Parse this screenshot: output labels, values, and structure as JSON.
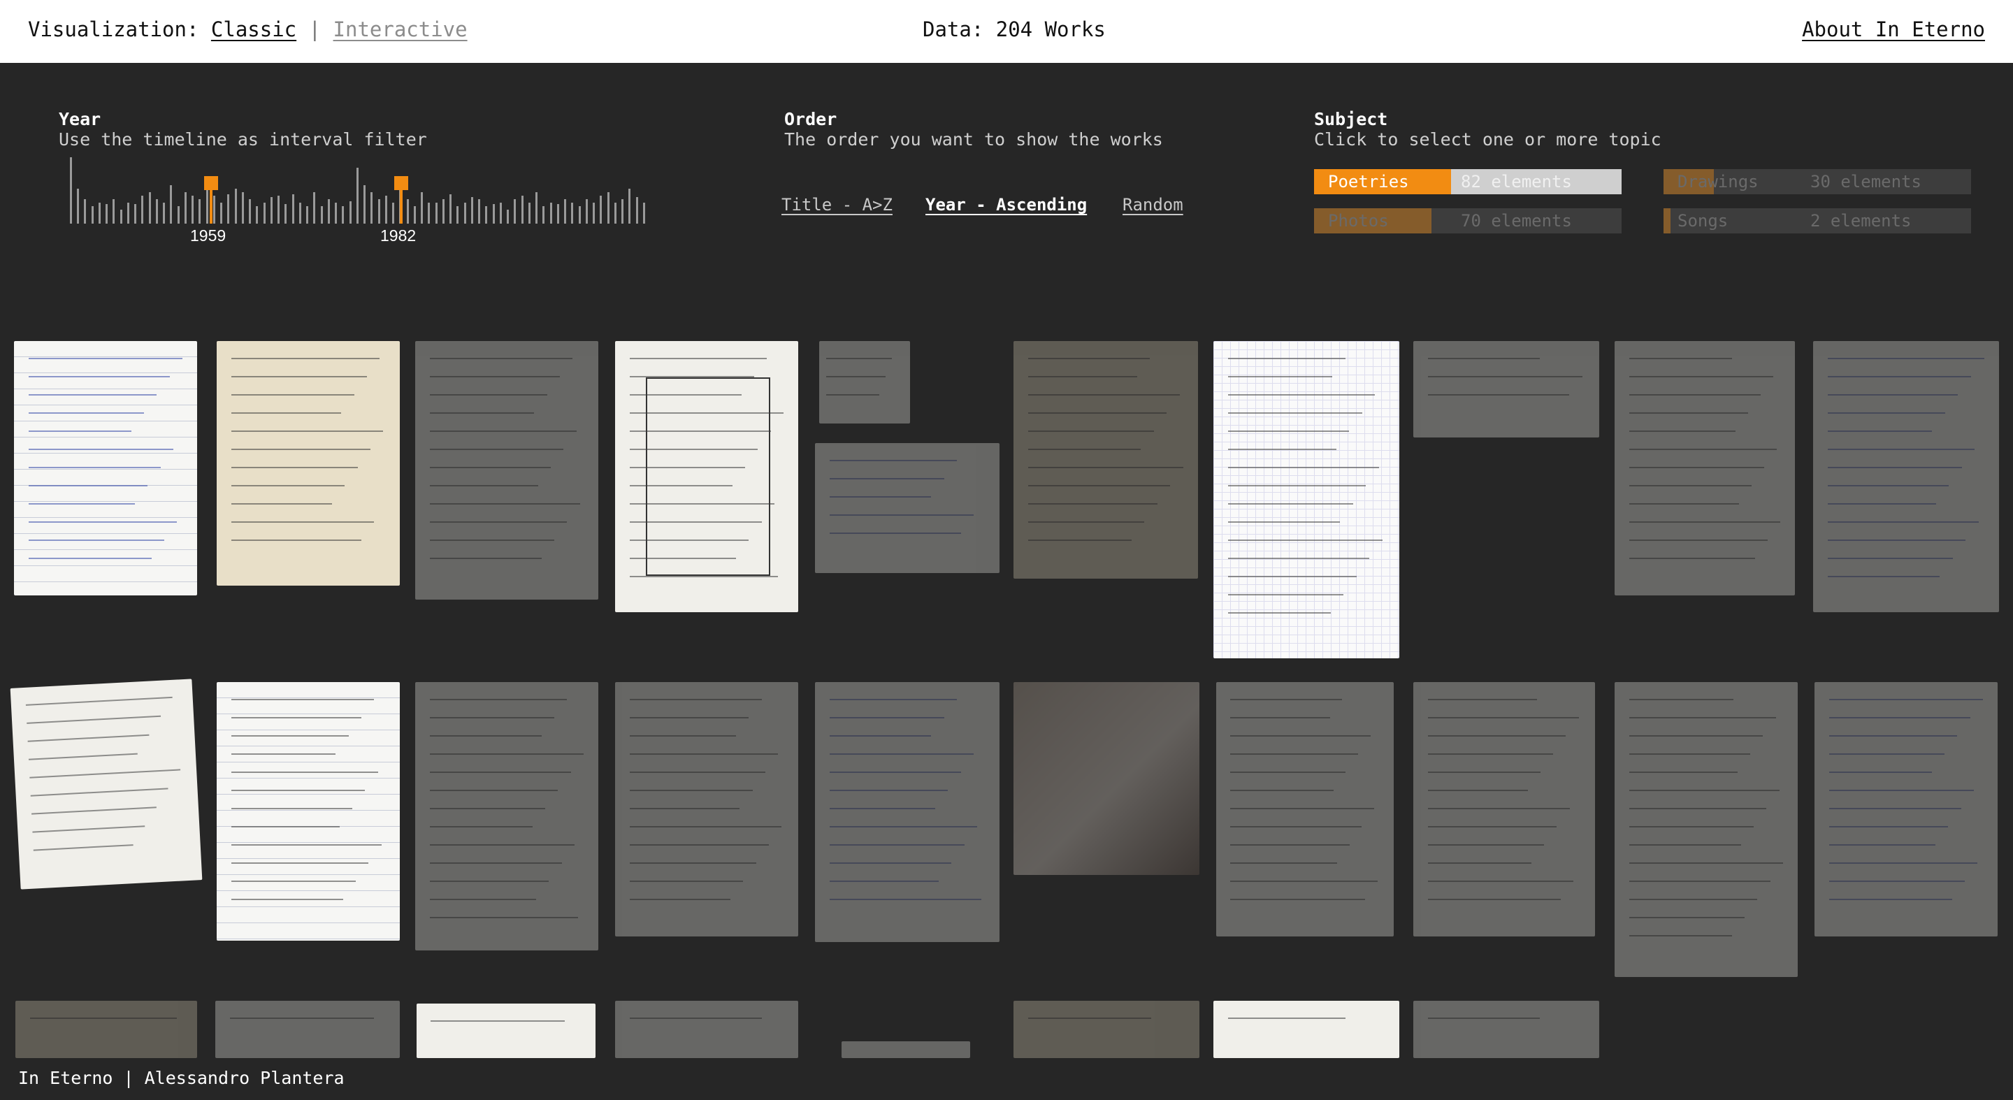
{
  "header": {
    "viz_label": "Visualization:",
    "viz_classic": "Classic",
    "viz_sep": "|",
    "viz_interactive": "Interactive",
    "data_label": "Data: 204 Works",
    "about": "About In Eterno"
  },
  "year": {
    "title": "Year",
    "subtitle": "Use the timeline as interval filter",
    "start_label": "1959",
    "end_label": "1982",
    "histogram_relative_counts": [
      0.95,
      0.5,
      0.35,
      0.25,
      0.3,
      0.28,
      0.35,
      0.2,
      0.3,
      0.28,
      0.4,
      0.45,
      0.35,
      0.3,
      0.55,
      0.25,
      0.45,
      0.4,
      0.35,
      0.48,
      0.4,
      0.3,
      0.42,
      0.5,
      0.45,
      0.35,
      0.25,
      0.3,
      0.38,
      0.4,
      0.28,
      0.42,
      0.3,
      0.25,
      0.45,
      0.25,
      0.35,
      0.3,
      0.25,
      0.32,
      0.8,
      0.55,
      0.45,
      0.35,
      0.4,
      0.3,
      0.5,
      0.35,
      0.25,
      0.45,
      0.3,
      0.3,
      0.35,
      0.42,
      0.25,
      0.3,
      0.38,
      0.35,
      0.25,
      0.28,
      0.3,
      0.2,
      0.35,
      0.4,
      0.3,
      0.45,
      0.25,
      0.3,
      0.28,
      0.35,
      0.3,
      0.25,
      0.35,
      0.3,
      0.4,
      0.45,
      0.3,
      0.35,
      0.5,
      0.38,
      0.3
    ]
  },
  "order": {
    "title": "Order",
    "subtitle": "The order you want to show the works",
    "options": [
      "Title - A>Z",
      "Year - Ascending",
      "Random"
    ],
    "selected": "Year - Ascending"
  },
  "subject": {
    "title": "Subject",
    "subtitle": "Click to select one or more topic",
    "items": [
      {
        "name": "Poetries",
        "count": "82 elements",
        "share": 0.44,
        "selected": true
      },
      {
        "name": "Drawings",
        "count": "30 elements",
        "share": 0.16,
        "selected": false
      },
      {
        "name": "Photos",
        "count": "70 elements",
        "share": 0.38,
        "selected": false
      },
      {
        "name": "Songs",
        "count": "2 elements",
        "share": 0.02,
        "selected": false
      }
    ]
  },
  "cards": {
    "row1_states": [
      "highlight",
      "highlight",
      "dim",
      "highlight",
      "dim",
      "dim",
      "highlight",
      "dim",
      "dim",
      "dim"
    ],
    "row2_states": [
      "highlight",
      "highlight",
      "dim",
      "dim",
      "dim",
      "dim",
      "dim",
      "dim",
      "dim",
      "dim"
    ]
  },
  "footer": {
    "credit": "In Eterno | Alessandro Plantera"
  },
  "colors": {
    "accent": "#f28c12",
    "background": "#262626",
    "topbar": "#ffffff"
  }
}
